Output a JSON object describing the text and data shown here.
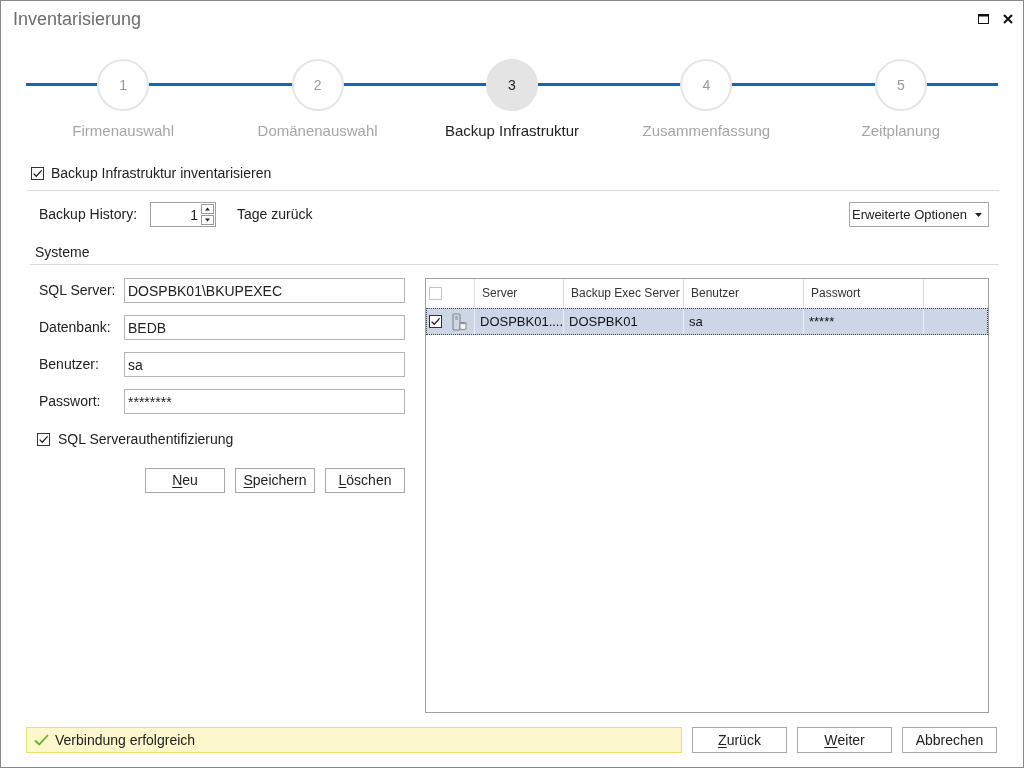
{
  "window": {
    "title": "Inventarisierung"
  },
  "steps": [
    {
      "number": "1",
      "label": "Firmenauswahl",
      "selected": false
    },
    {
      "number": "2",
      "label": "Domänenauswahl",
      "selected": false
    },
    {
      "number": "3",
      "label": "Backup Infrastruktur",
      "selected": true
    },
    {
      "number": "4",
      "label": "Zusammenfassung",
      "selected": false
    },
    {
      "number": "5",
      "label": "Zeitplanung",
      "selected": false
    }
  ],
  "inventory_checkbox": {
    "label": "Backup Infrastruktur inventarisieren",
    "checked": true
  },
  "backup_history": {
    "label": "Backup History:",
    "value": "1",
    "unit": "Tage zurück"
  },
  "advanced_options_button": {
    "label": "Erweiterte Optionen"
  },
  "systems": {
    "title": "Systeme",
    "fields": [
      {
        "label": "SQL Server:",
        "value": "DOSPBK01\\BKUPEXEC"
      },
      {
        "label": "Datenbank:",
        "value": "BEDB"
      },
      {
        "label": "Benutzer:",
        "value": "sa"
      },
      {
        "label": "Passwort:",
        "value": "********"
      }
    ],
    "sql_auth_checkbox": {
      "label": "SQL Serverauthentifizierung",
      "checked": true
    },
    "buttons": [
      {
        "label": "Neu",
        "access_key_underlined": true
      },
      {
        "label": "Speichern",
        "access_key_underlined": true
      },
      {
        "label": "Löschen",
        "access_key_underlined": true
      }
    ]
  },
  "table": {
    "header_checkbox": {
      "checked": false
    },
    "columns": [
      "Server",
      "Backup Exec Server",
      "Benutzer",
      "Passwort"
    ],
    "rows": [
      {
        "checked": true,
        "selected": true,
        "cells": [
          "DOSPBK01....",
          "DOSPBK01",
          "sa",
          "*****"
        ]
      }
    ]
  },
  "status": {
    "text": "Verbindung erfolgreich"
  },
  "buttons": [
    {
      "label": "Zurück",
      "access_key_underlined": true
    },
    {
      "label": "Weiter",
      "access_key_underlined": true
    },
    {
      "label": "Abbrechen",
      "access_key_underlined": false
    }
  ]
}
